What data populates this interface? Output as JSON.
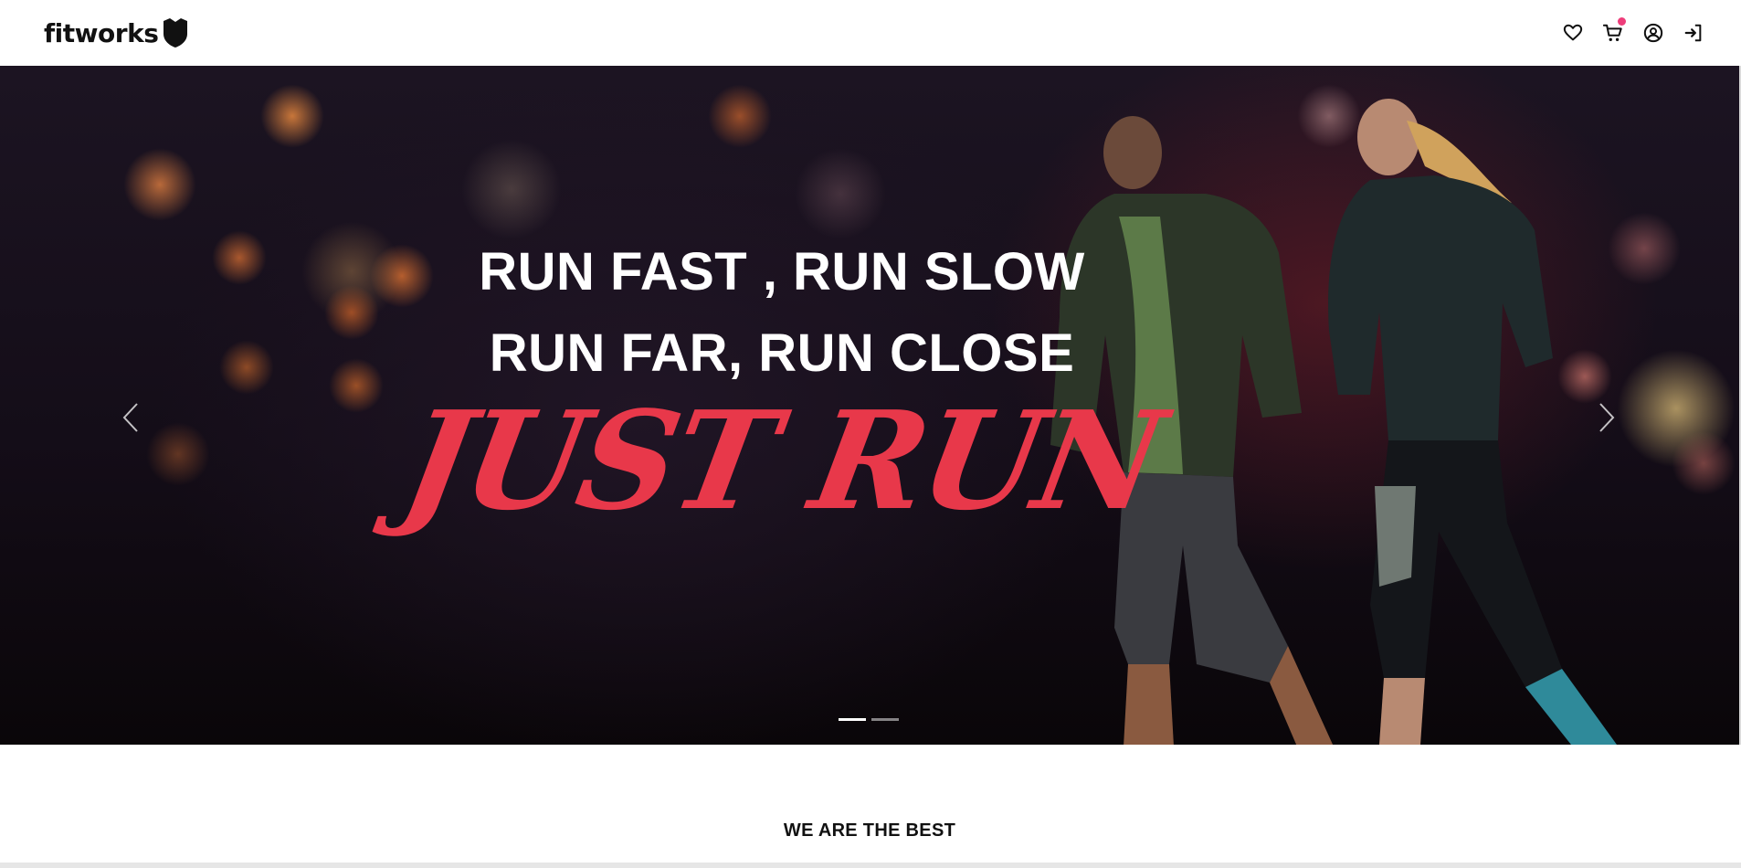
{
  "header": {
    "logo_text": "fitworks",
    "icons": [
      "heart-icon",
      "cart-icon",
      "user-icon",
      "sign-in-icon"
    ],
    "cart_badge_color": "#ee3d7a"
  },
  "hero": {
    "line1": "RUN FAST , RUN SLOW",
    "line2": "RUN FAR, RUN CLOSE",
    "accent": "JUST RUN",
    "accent_color": "#e8384a",
    "slides_total": 2,
    "active_slide": 1
  },
  "section": {
    "title": "WE ARE THE BEST"
  }
}
